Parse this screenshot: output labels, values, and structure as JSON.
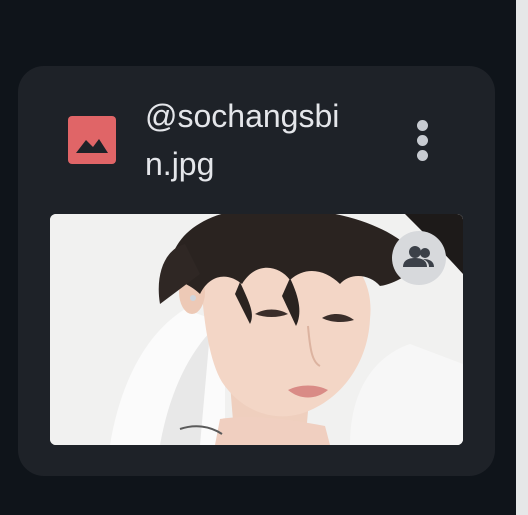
{
  "file": {
    "name": "@sochangsbin.jpg",
    "type_icon": "image-icon",
    "icon_color": "#e06567"
  },
  "menu": {
    "icon": "more-vert-icon"
  },
  "thumbnail": {
    "badge_icon": "shared-people-icon"
  },
  "colors": {
    "background": "#0f141a",
    "card": "#1e2228",
    "text": "#e4e6ea"
  }
}
